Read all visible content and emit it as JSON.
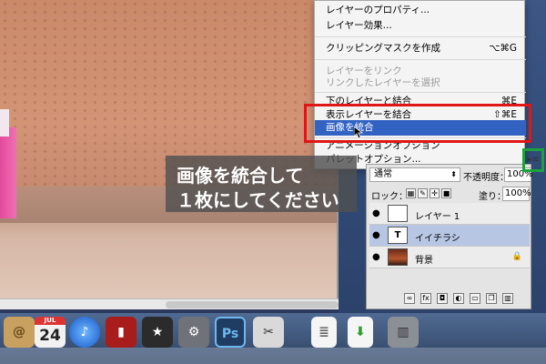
{
  "context_menu": {
    "items": [
      {
        "label": "レイヤーのプロパティ...",
        "shortcut": "",
        "state": "normal"
      },
      {
        "label": "レイヤー効果...",
        "shortcut": "",
        "state": "normal"
      },
      {
        "label": "クリッピングマスクを作成",
        "shortcut": "⌥⌘G",
        "state": "normal"
      },
      {
        "label": "レイヤーをリンク",
        "shortcut": "",
        "state": "disabled"
      },
      {
        "label": "リンクしたレイヤーを選択",
        "shortcut": "",
        "state": "disabled"
      },
      {
        "label": "下のレイヤーと結合",
        "shortcut": "⌘E",
        "state": "normal"
      },
      {
        "label": "表示レイヤーを結合",
        "shortcut": "⇧⌘E",
        "state": "normal"
      },
      {
        "label": "画像を統合",
        "shortcut": "",
        "state": "selected"
      },
      {
        "label": "アニメーションオプション",
        "shortcut": "",
        "state": "normal"
      },
      {
        "label": "パレットオプション...",
        "shortcut": "",
        "state": "normal"
      }
    ]
  },
  "instruction": {
    "line1": "画像を統合して",
    "line2": "１枚にしてください"
  },
  "layers_panel": {
    "blend_mode": "通常",
    "opacity_label": "不透明度：",
    "opacity_value": "100%",
    "lock_label": "ロック：",
    "fill_label": "塗り：",
    "fill_value": "100%",
    "layers": [
      {
        "name": "レイヤー 1",
        "thumb": "",
        "selected": false
      },
      {
        "name": "イイチラシ",
        "thumb": "T",
        "selected": true
      },
      {
        "name": "背景",
        "thumb": "",
        "selected": false
      }
    ],
    "footer_icons": [
      "link-icon",
      "fx-icon",
      "mask-icon",
      "adjustment-icon",
      "folder-icon",
      "new-layer-icon",
      "trash-icon"
    ]
  },
  "dock": {
    "calendar_day": "24",
    "calendar_month": "JUL",
    "photoshop_label": "Ps",
    "icons": [
      "address-book-icon",
      "calendar-icon",
      "itunes-icon",
      "photo-booth-icon",
      "imovie-icon",
      "iphoto-icon",
      "system-preferences-icon",
      "photoshop-icon",
      "scissors-icon",
      "document-icon",
      "download-document-icon",
      "trash-icon"
    ]
  },
  "colors": {
    "highlight_red": "#e01616",
    "highlight_green": "#1aa33b",
    "menu_selection": "#3263c3"
  }
}
